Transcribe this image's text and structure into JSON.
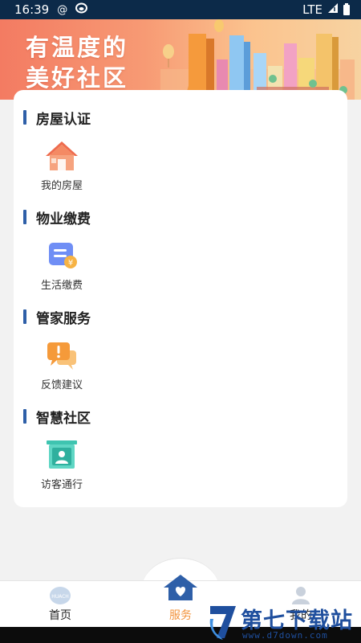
{
  "status_bar": {
    "time": "16:39",
    "network": "LTE",
    "icons": [
      "at-icon",
      "app-notification-icon",
      "signal-icon",
      "battery-icon"
    ]
  },
  "banner": {
    "line1": "有温度的",
    "line2": "美好社区"
  },
  "sections": [
    {
      "title": "房屋认证",
      "items": [
        {
          "label": "我的房屋",
          "icon": "house-icon"
        }
      ]
    },
    {
      "title": "物业缴费",
      "items": [
        {
          "label": "生活缴费",
          "icon": "bill-payment-icon"
        }
      ]
    },
    {
      "title": "管家服务",
      "items": [
        {
          "label": "反馈建议",
          "icon": "feedback-chat-icon"
        }
      ]
    },
    {
      "title": "智慧社区",
      "items": [
        {
          "label": "访客通行",
          "icon": "visitor-pass-icon"
        }
      ]
    }
  ],
  "bottom_nav": {
    "items": [
      {
        "label": "首页",
        "icon": "home-logo-icon",
        "active": false
      },
      {
        "label": "服务",
        "icon": "service-house-icon",
        "active": true
      },
      {
        "label": "我的",
        "icon": "profile-icon",
        "active": false
      }
    ],
    "active_color": "#f2943e"
  },
  "watermark": {
    "name": "第七下载站",
    "url": "www.d7down.com"
  },
  "colors": {
    "status_bar": "#0c2a49",
    "section_accent": "#2e5fa8",
    "banner_start": "#f37b62",
    "banner_end": "#f7d3a1"
  }
}
